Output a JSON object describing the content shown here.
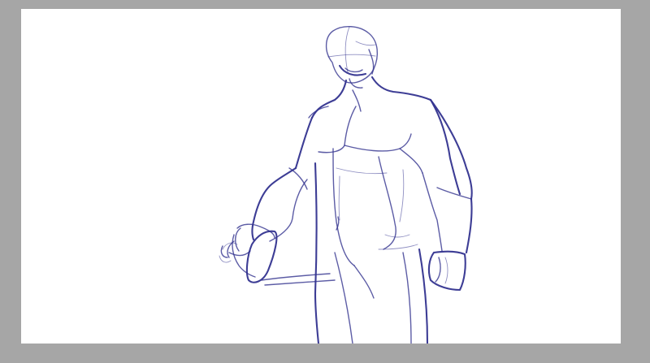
{
  "colors": {
    "workspace_background": "#a6a6a6",
    "canvas_background": "#ffffff",
    "sketch_stroke": "#33338f"
  }
}
